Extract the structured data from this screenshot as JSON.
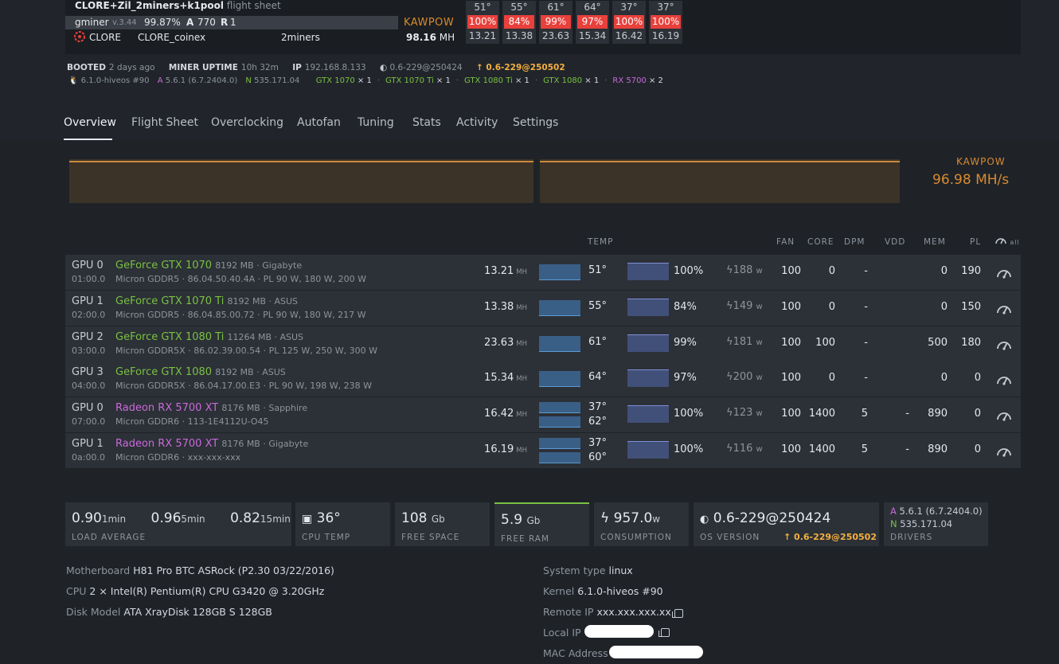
{
  "flight_sheet": {
    "title": "CLORE+Zil_2miners+k1pool",
    "suffix": "flight sheet"
  },
  "miner": {
    "name": "gminer",
    "version": "v.3.44",
    "accept_rate": "99.87%",
    "a_label": "A",
    "accepted": "770",
    "r_label": "R",
    "rejected": "1",
    "coin": "CLORE",
    "wallet": "CLORE_coinex",
    "pool": "2miners",
    "algo": "KAWPOW",
    "hashrate": "98.16",
    "hashrate_unit": "MH"
  },
  "gpu_summary": [
    {
      "temp": "51°",
      "fan": "100%",
      "hr": "13.21"
    },
    {
      "temp": "55°",
      "fan": "84%",
      "hr": "13.38"
    },
    {
      "temp": "61°",
      "fan": "99%",
      "hr": "23.63"
    },
    {
      "temp": "64°",
      "fan": "97%",
      "hr": "15.34"
    },
    {
      "temp": "37°",
      "fan": "100%",
      "hr": "16.42"
    },
    {
      "temp": "37°",
      "fan": "100%",
      "hr": "16.19"
    }
  ],
  "status": {
    "booted_label": "BOOTED",
    "booted": "2 days ago",
    "uptime_label": "MINER UPTIME",
    "uptime": "10h 32m",
    "ip_label": "IP",
    "ip": "192.168.8.133",
    "os": "0.6-229@250424",
    "os_update": "0.6-229@250502"
  },
  "hardware": {
    "kernel": "6.1.0-hiveos #90",
    "amd_label": "A",
    "amd": "5.6.1 (6.7.2404.0)",
    "nv_label": "N",
    "nv": "535.171.04",
    "cards": [
      {
        "name": "GTX 1070",
        "count": "× 1"
      },
      {
        "name": "GTX 1070 Ti",
        "count": "× 1"
      },
      {
        "name": "GTX 1080 Ti",
        "count": "× 1"
      },
      {
        "name": "GTX 1080",
        "count": "× 1"
      },
      {
        "name": "RX 5700",
        "count": "× 2"
      }
    ]
  },
  "tabs": [
    "Overview",
    "Flight Sheet",
    "Overclocking",
    "Autofan",
    "Tuning",
    "Stats",
    "Activity",
    "Settings"
  ],
  "hashrate_chart": {
    "algo": "KAWPOW",
    "value": "96.98 MH/s"
  },
  "table_headers": {
    "temp": "TEMP",
    "fan": "FAN",
    "core": "CORE",
    "dpm": "DPM",
    "vdd": "VDD",
    "mem": "MEM",
    "pl": "PL",
    "all": "all"
  },
  "gpus": [
    {
      "idx": "GPU 0",
      "bus": "01:00.0",
      "name": "GeForce GTX 1070",
      "vram": "8192 MB · Gigabyte",
      "mem": "Micron GDDR5 · 86.04.50.40.4A · PL 90 W, 180 W, 200 W",
      "hr": "13.21",
      "hr_unit": "MH",
      "temp": "51°",
      "temp2": "",
      "fan_pct": "100%",
      "watt": "188",
      "watt_unit": "w",
      "fan": "100",
      "core": "0",
      "dpm": "-",
      "vdd": "",
      "memclk": "0",
      "pl": "190"
    },
    {
      "idx": "GPU 1",
      "bus": "02:00.0",
      "name": "GeForce GTX 1070 Ti",
      "vram": "8192 MB · ASUS",
      "mem": "Micron GDDR5 · 86.04.85.00.72 · PL 90 W, 180 W, 217 W",
      "hr": "13.38",
      "hr_unit": "MH",
      "temp": "55°",
      "temp2": "",
      "fan_pct": "84%",
      "watt": "149",
      "watt_unit": "w",
      "fan": "100",
      "core": "0",
      "dpm": "-",
      "vdd": "",
      "memclk": "0",
      "pl": "150"
    },
    {
      "idx": "GPU 2",
      "bus": "03:00.0",
      "name": "GeForce GTX 1080 Ti",
      "vram": "11264 MB · ASUS",
      "mem": "Micron GDDR5X · 86.02.39.00.54 · PL 125 W, 250 W, 300 W",
      "hr": "23.63",
      "hr_unit": "MH",
      "temp": "61°",
      "temp2": "",
      "fan_pct": "99%",
      "watt": "181",
      "watt_unit": "w",
      "fan": "100",
      "core": "100",
      "dpm": "-",
      "vdd": "",
      "memclk": "500",
      "pl": "180"
    },
    {
      "idx": "GPU 3",
      "bus": "04:00.0",
      "name": "GeForce GTX 1080",
      "vram": "8192 MB · ASUS",
      "mem": "Micron GDDR5X · 86.04.17.00.E3 · PL 90 W, 198 W, 238 W",
      "hr": "15.34",
      "hr_unit": "MH",
      "temp": "64°",
      "temp2": "",
      "fan_pct": "97%",
      "watt": "200",
      "watt_unit": "w",
      "fan": "100",
      "core": "0",
      "dpm": "-",
      "vdd": "",
      "memclk": "0",
      "pl": "0"
    },
    {
      "idx": "GPU 0",
      "bus": "07:00.0",
      "name": "Radeon RX 5700 XT",
      "vram": "8176 MB · Sapphire",
      "mem": "Micron GDDR6 · 113-1E4112U-O45",
      "hr": "16.42",
      "hr_unit": "MH",
      "temp": "37°",
      "temp2": "62°",
      "fan_pct": "100%",
      "watt": "123",
      "watt_unit": "w",
      "fan": "100",
      "core": "1400",
      "dpm": "5",
      "vdd": "-",
      "memclk": "890",
      "pl": "0"
    },
    {
      "idx": "GPU 1",
      "bus": "0a:00.0",
      "name": "Radeon RX 5700 XT",
      "vram": "8176 MB · Gigabyte",
      "mem": "Micron GDDR6 · xxx-xxx-xxx",
      "hr": "16.19",
      "hr_unit": "MH",
      "temp": "37°",
      "temp2": "60°",
      "fan_pct": "100%",
      "watt": "116",
      "watt_unit": "w",
      "fan": "100",
      "core": "1400",
      "dpm": "5",
      "vdd": "-",
      "memclk": "890",
      "pl": "0"
    }
  ],
  "stats": {
    "load1": "0.90",
    "load1_u": "1min",
    "load5": "0.96",
    "load5_u": "5min",
    "load15": "0.82",
    "load15_u": "15min",
    "load_label": "LOAD AVERAGE",
    "cpu_temp": "36°",
    "cpu_temp_label": "CPU TEMP",
    "free_space": "108",
    "free_space_u": "Gb",
    "free_space_label": "FREE SPACE",
    "free_ram": "5.9",
    "free_ram_u": "Gb",
    "free_ram_label": "FREE RAM",
    "consumption": "957.0",
    "consumption_u": "w",
    "consumption_label": "CONSUMPTION",
    "os": "0.6-229@250424",
    "os_update": "0.6-229@250502",
    "os_label": "OS VERSION",
    "drv_a_label": "A",
    "drv_a": "5.6.1 (6.7.2404.0)",
    "drv_n_label": "N",
    "drv_n": "535.171.04",
    "drivers_label": "DRIVERS"
  },
  "info": {
    "motherboard_label": "Motherboard",
    "motherboard": "H81 Pro BTC ASRock (P2.30 03/22/2016)",
    "cpu_label": "CPU",
    "cpu": "2 × Intel(R) Pentium(R) CPU G3420 @ 3.20GHz",
    "disk_label": "Disk Model",
    "disk": "ATA XrayDisk 128GB S 128GB",
    "systype_label": "System type",
    "systype": "linux",
    "kernel_label": "Kernel",
    "kernel": "6.1.0-hiveos #90",
    "remote_ip_label": "Remote IP",
    "remote_ip": "xxx.xxx.xxx.xx",
    "local_ip_label": "Local IP",
    "mac_label": "MAC Address"
  },
  "colors": {
    "nvidia": "#79c142",
    "amd": "#c86ad9",
    "accent": "#d98a2e",
    "alert": "#e8403b",
    "update": "#f5b040"
  }
}
